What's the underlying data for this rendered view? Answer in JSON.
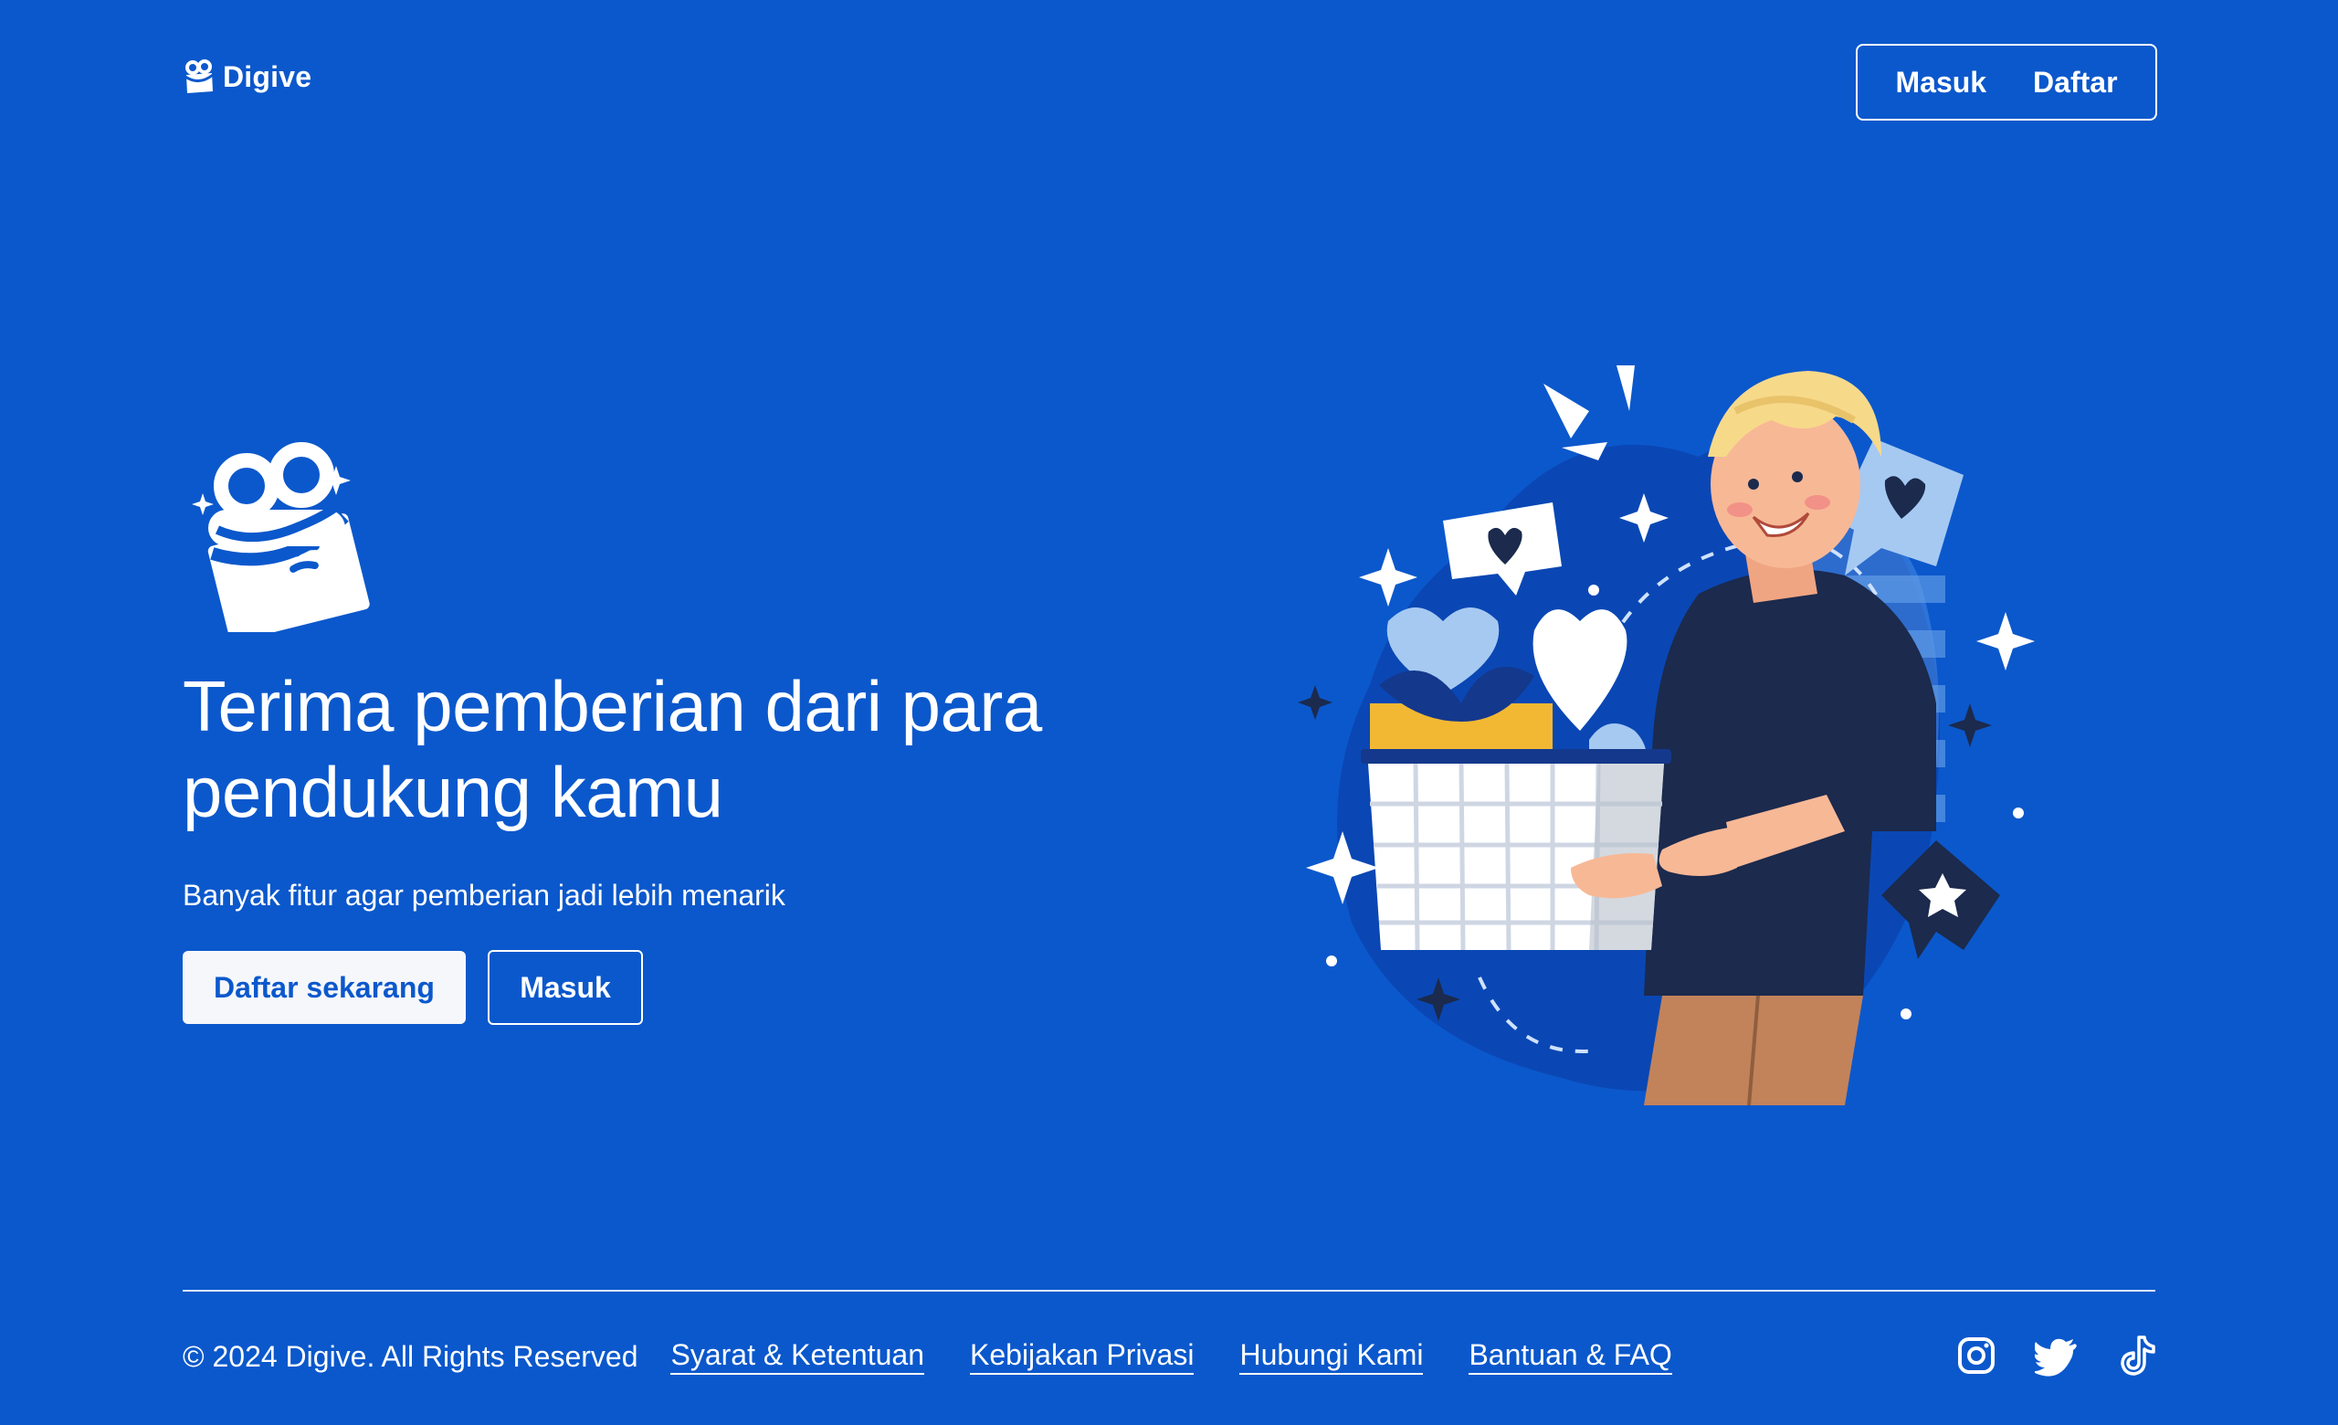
{
  "header": {
    "brand": "Digive",
    "login_label": "Masuk",
    "register_label": "Daftar"
  },
  "hero": {
    "title": "Terima pemberian dari para pendukung kamu",
    "subtitle": "Banyak fitur agar pemberian jadi lebih menarik",
    "primary_cta": "Daftar sekarang",
    "secondary_cta": "Masuk"
  },
  "footer": {
    "copyright": "© 2024 Digive. All Rights Reserved",
    "links": [
      "Syarat & Ketentuan",
      "Kebijakan Privasi",
      "Hubungi Kami",
      "Bantuan & FAQ"
    ],
    "socials": [
      "instagram-icon",
      "twitter-icon",
      "tiktok-icon"
    ]
  },
  "colors": {
    "background": "#0b58cc",
    "primary_button_bg": "#f5f7fb",
    "primary_button_text": "#0b58cc",
    "text": "#ffffff"
  }
}
